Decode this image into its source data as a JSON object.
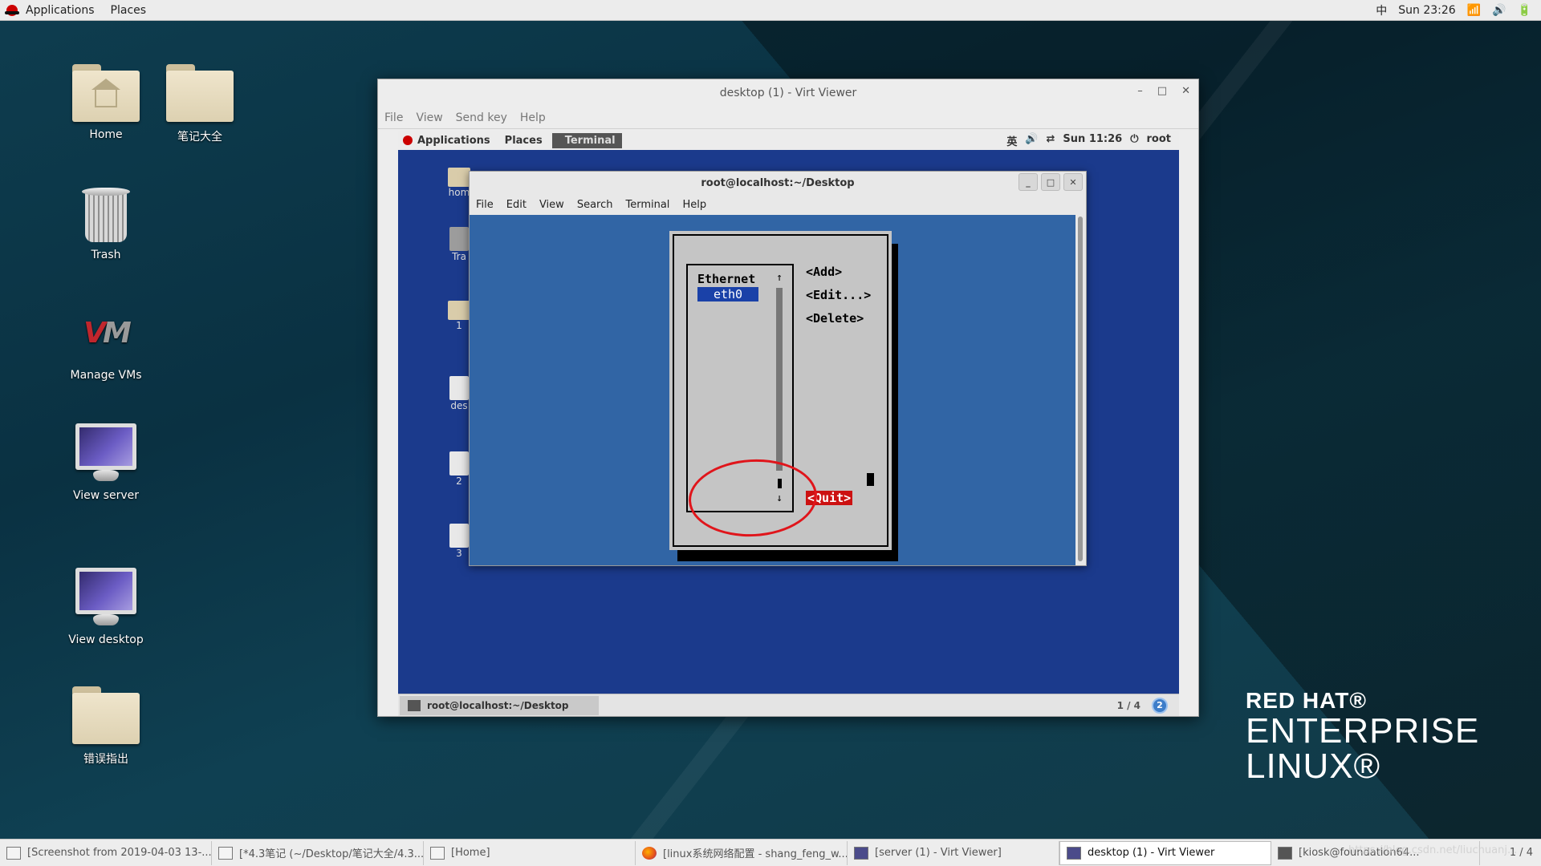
{
  "topbar": {
    "applications": "Applications",
    "places": "Places",
    "input_method": "中",
    "clock": "Sun 23:26"
  },
  "desktop_icons": {
    "home": "Home",
    "notes_folder": "笔记大全",
    "trash": "Trash",
    "manage_vms": "Manage VMs",
    "view_server": "View server",
    "view_desktop": "View desktop",
    "errors_folder": "错误指出"
  },
  "virt_viewer": {
    "title": "desktop (1) - Virt Viewer",
    "menu": [
      "File",
      "View",
      "Send key",
      "Help"
    ]
  },
  "guest": {
    "topbar": {
      "applications": "Applications",
      "places": "Places",
      "terminal": "Terminal",
      "input_method": "英",
      "clock": "Sun 11:26",
      "user": "root"
    },
    "icons": [
      "hom",
      "Tra",
      "1",
      "des",
      "2",
      "3"
    ],
    "taskbar_item": "root@localhost:~/Desktop",
    "pager": "1 / 4",
    "notification_count": "2"
  },
  "terminal": {
    "title": "root@localhost:~/Desktop",
    "menu": [
      "File",
      "Edit",
      "View",
      "Search",
      "Terminal",
      "Help"
    ]
  },
  "nmtui": {
    "list_header": "Ethernet",
    "selected_item": "eth0",
    "add": "<Add>",
    "edit": "<Edit...>",
    "delete": "<Delete>",
    "quit": "<Quit>"
  },
  "brand": {
    "line1": "RED HAT®",
    "line2": "ENTERPRISE",
    "line3": "LINUX®"
  },
  "taskbar": {
    "items": [
      "[Screenshot from 2019-04-03 13-...",
      "[*4.3笔记 (~/Desktop/笔记大全/4.3...",
      "[Home]",
      "[linux系统网络配置 - shang_feng_w...",
      "[server (1) - Virt Viewer]",
      "desktop (1) - Virt Viewer",
      "[kiosk@foundation64..."
    ],
    "pager": "1 / 4"
  },
  "watermark": "https://blog.csdn.net/liuchuanj..."
}
